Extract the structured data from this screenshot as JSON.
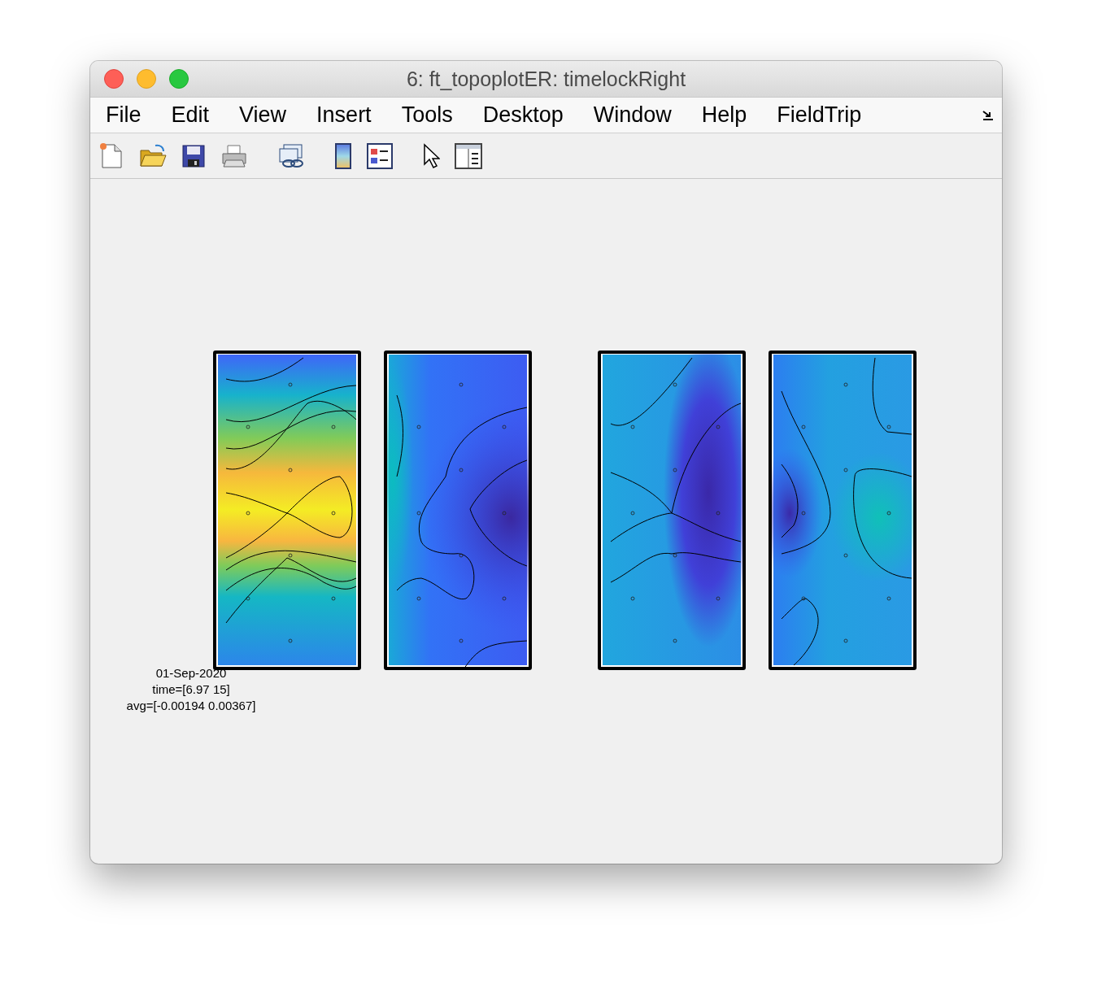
{
  "window": {
    "title": "6: ft_topoplotER: timelockRight"
  },
  "menu": [
    "File",
    "Edit",
    "View",
    "Insert",
    "Tools",
    "Desktop",
    "Window",
    "Help",
    "FieldTrip"
  ],
  "figure": {
    "annotation": [
      "01-Sep-2020",
      "time=[6.97 15]",
      "avg=[-0.00194 0.00367]"
    ]
  }
}
